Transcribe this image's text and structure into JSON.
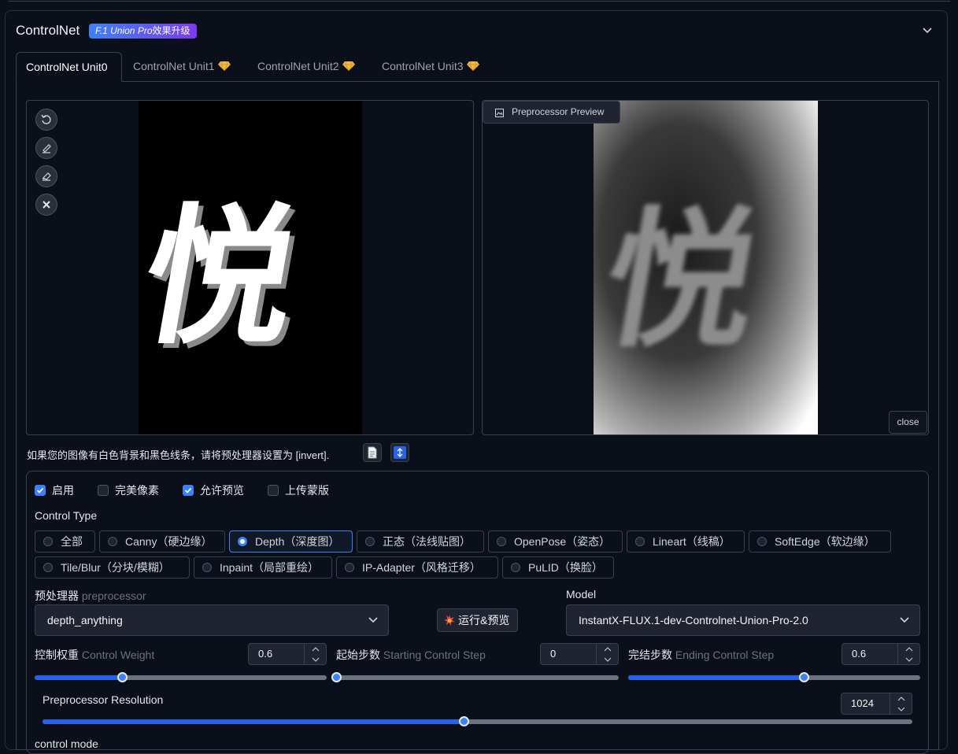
{
  "section": {
    "title": "ControlNet",
    "badge_italic": "F.1 Union Pro",
    "badge_text": "效果升级"
  },
  "tabs": [
    {
      "label": "ControlNet Unit0",
      "active": true
    },
    {
      "label": "ControlNet Unit1"
    },
    {
      "label": "ControlNet Unit2"
    },
    {
      "label": "ControlNet Unit3"
    }
  ],
  "input_image": {
    "glyph": "悦"
  },
  "preview": {
    "button_label": "Preprocessor Preview",
    "glyph": "悦",
    "close_label": "close"
  },
  "note": "如果您的图像有白色背景和黑色线条，请将预处理器设置为 [invert].",
  "options": [
    {
      "label": "启用",
      "checked": true
    },
    {
      "label": "完美像素",
      "checked": false
    },
    {
      "label": "允许预览",
      "checked": true
    },
    {
      "label": "上传蒙版",
      "checked": false
    }
  ],
  "control_type": {
    "label": "Control Type",
    "items": [
      "全部",
      "Canny（硬边缘）",
      "Depth（深度图）",
      "正态（法线贴图）",
      "OpenPose（姿态）",
      "Lineart（线稿）",
      "SoftEdge（软边缘）",
      "Tile/Blur（分块/模糊）",
      "Inpaint（局部重绘）",
      "IP-Adapter（风格迁移）",
      "PuLID（换脸）"
    ],
    "selected": "Depth（深度图）"
  },
  "preprocessor": {
    "label_cn": "预处理器",
    "label_en": "preprocessor",
    "value": "depth_anything"
  },
  "run_button": "运行&预览",
  "model": {
    "label": "Model",
    "value": "InstantX-FLUX.1-dev-Controlnet-Union-Pro-2.0"
  },
  "control_weight": {
    "label_cn": "控制权重",
    "label_en": "Control Weight",
    "value": "0.6",
    "min": 0,
    "max": 2
  },
  "start_step": {
    "label_cn": "起始步数",
    "label_en": "Starting Control Step",
    "value": "0",
    "min": 0,
    "max": 1
  },
  "end_step": {
    "label_cn": "完结步数",
    "label_en": "Ending Control Step",
    "value": "0.6",
    "min": 0,
    "max": 1
  },
  "resolution": {
    "label": "Preprocessor Resolution",
    "value": "1024",
    "min": 64,
    "max": 2048
  },
  "control_mode_label": "control mode",
  "colors": {
    "accent": "#3b82f6",
    "background": "#0b0f19",
    "border": "#374151"
  }
}
